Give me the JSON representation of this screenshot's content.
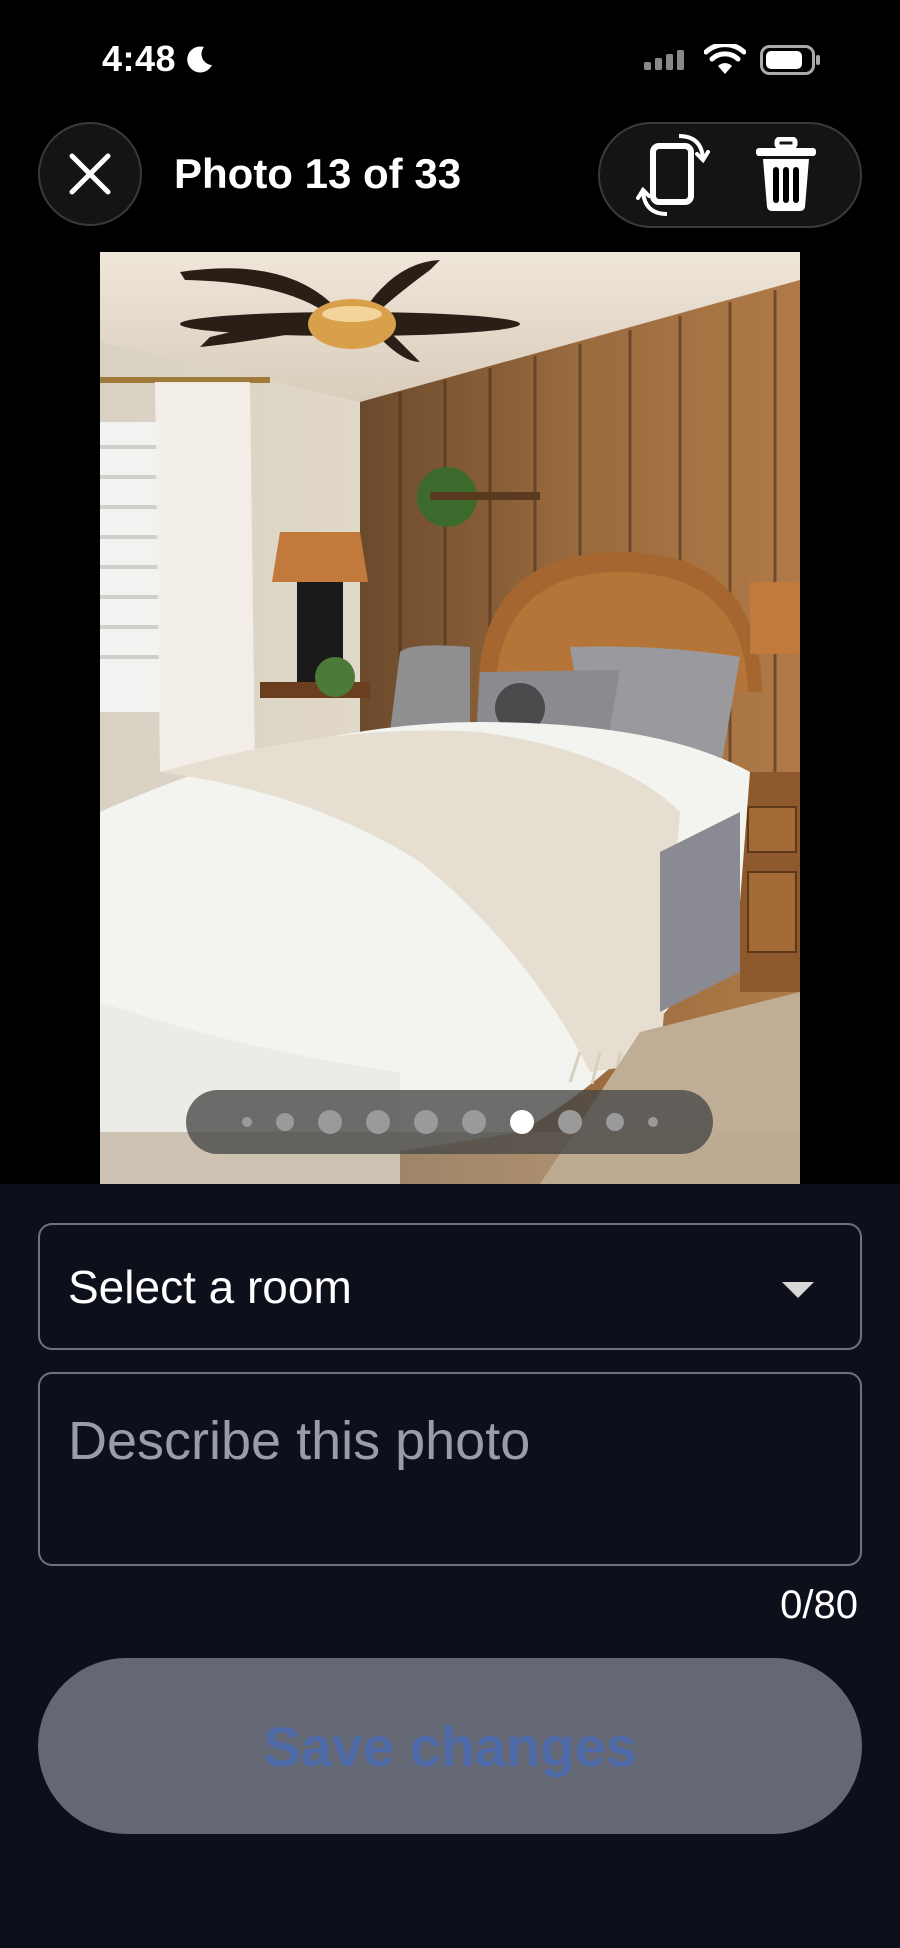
{
  "status_bar": {
    "time": "4:48",
    "icons": [
      "moon-icon",
      "signal-icon",
      "wifi-icon",
      "battery-icon"
    ]
  },
  "header": {
    "title": "Photo 13 of 33",
    "close_icon": "close-icon",
    "rotate_icon": "rotate-icon",
    "delete_icon": "trash-icon"
  },
  "photo": {
    "description": "bedroom",
    "pager": {
      "total_dots": 10,
      "active_index": 6
    }
  },
  "form": {
    "room_select": {
      "value": "Select a room",
      "icon": "chevron-down-icon"
    },
    "description": {
      "placeholder": "Describe this photo",
      "value": ""
    },
    "counter": "0/80",
    "save_label": "Save changes"
  },
  "colors": {
    "background": "#000000",
    "panel": "#0d0f1a",
    "save_button": "#646875",
    "save_text": "#4f6aa8"
  }
}
